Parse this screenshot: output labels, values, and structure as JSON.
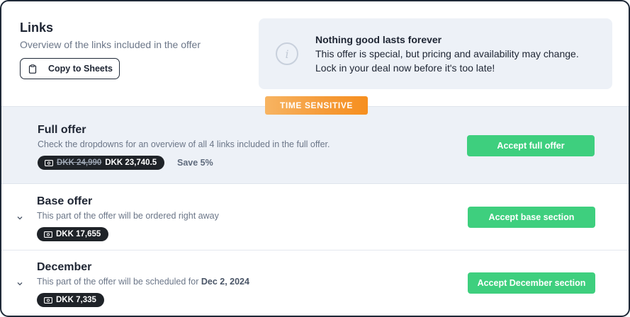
{
  "header": {
    "title": "Links",
    "subtitle": "Overview of the links included in the offer",
    "copy_button": "Copy to Sheets"
  },
  "notice": {
    "title": "Nothing good lasts forever",
    "line1": "This offer is special, but pricing and availability may change.",
    "line2": "Lock in your deal now before it's too late!",
    "icon": "info-icon"
  },
  "badge": "TIME SENSITIVE",
  "full_offer": {
    "title": "Full offer",
    "description": "Check the dropdowns for an overview of all 4 links included in the full offer.",
    "old_price": "DKK 24,990",
    "price": "DKK 23,740.5",
    "save": "Save 5%",
    "button": "Accept full offer"
  },
  "base_offer": {
    "title": "Base offer",
    "description": "This part of the offer will be ordered right away",
    "price": "DKK 17,655",
    "button": "Accept base section"
  },
  "december_offer": {
    "title": "December",
    "description_prefix": "This part of the offer will be scheduled for ",
    "description_date": "Dec 2, 2024",
    "price": "DKK 7,335",
    "button": "Accept December section"
  },
  "colors": {
    "accent_green": "#3ecf7e",
    "badge_orange": "#f59a37",
    "pill_dark": "#1f2328",
    "panel_bg": "#edf1f7"
  }
}
